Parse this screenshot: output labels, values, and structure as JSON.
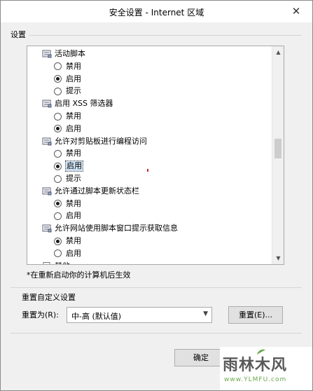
{
  "window": {
    "title": "安全设置 - Internet 区域"
  },
  "settings_group": {
    "title": "设置"
  },
  "tree": {
    "rows": [
      {
        "kind": "category",
        "label": "活动脚本"
      },
      {
        "kind": "option",
        "label": "禁用",
        "checked": false,
        "selected": false
      },
      {
        "kind": "option",
        "label": "启用",
        "checked": true,
        "selected": false
      },
      {
        "kind": "option",
        "label": "提示",
        "checked": false,
        "selected": false
      },
      {
        "kind": "category",
        "label": "启用 XSS 筛选器"
      },
      {
        "kind": "option",
        "label": "禁用",
        "checked": false,
        "selected": false
      },
      {
        "kind": "option",
        "label": "启用",
        "checked": true,
        "selected": false
      },
      {
        "kind": "category",
        "label": "允许对剪贴板进行编程访问"
      },
      {
        "kind": "option",
        "label": "禁用",
        "checked": false,
        "selected": false
      },
      {
        "kind": "option",
        "label": "启用",
        "checked": true,
        "selected": true
      },
      {
        "kind": "option",
        "label": "提示",
        "checked": false,
        "selected": false
      },
      {
        "kind": "category",
        "label": "允许通过脚本更新状态栏"
      },
      {
        "kind": "option",
        "label": "禁用",
        "checked": true,
        "selected": false
      },
      {
        "kind": "option",
        "label": "启用",
        "checked": false,
        "selected": false
      },
      {
        "kind": "category",
        "label": "允许网站使用脚本窗口提示获取信息"
      },
      {
        "kind": "option",
        "label": "禁用",
        "checked": true,
        "selected": false
      },
      {
        "kind": "option",
        "label": "启用",
        "checked": false,
        "selected": false
      },
      {
        "kind": "category-doc",
        "label": "其他"
      }
    ]
  },
  "note": "*在重新启动你的计算机后生效",
  "reset_group": {
    "title": "重置自定义设置",
    "reset_to_label": "重置为(R):",
    "selected_value": "中-高 (默认值)",
    "reset_button": "重置(E)..."
  },
  "footer": {
    "ok_button": "确定"
  },
  "watermark": {
    "text": "雨林木风",
    "url": "www.YLMFU.com"
  },
  "colors": {
    "selection": "#cfe3f7",
    "accent_green": "#6aa84f"
  },
  "icons": {
    "close": "close-icon",
    "category": "settings-category-icon",
    "doc": "document-icon",
    "scroll_up": "scroll-up-arrow-icon",
    "scroll_down": "scroll-down-arrow-icon",
    "dropdown": "chevron-down-icon"
  }
}
